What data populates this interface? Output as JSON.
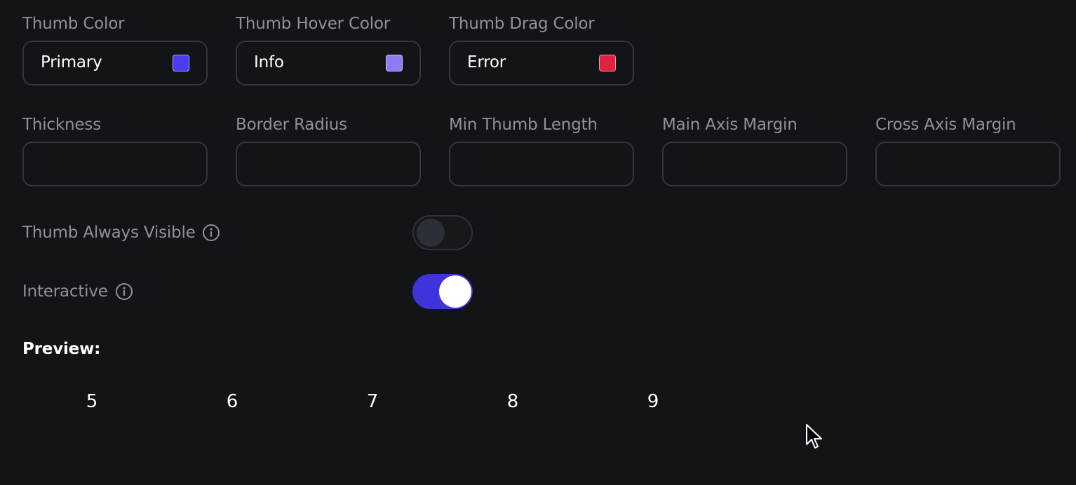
{
  "colors": {
    "thumb_color": {
      "label": "Thumb Color",
      "value": "Primary",
      "swatch": "#4a3cf0"
    },
    "thumb_hover_color": {
      "label": "Thumb Hover Color",
      "value": "Info",
      "swatch": "#8b7cf6"
    },
    "thumb_drag_color": {
      "label": "Thumb Drag Color",
      "value": "Error",
      "swatch": "#e2203f"
    }
  },
  "dimensions": {
    "thickness": {
      "label": "Thickness",
      "value": ""
    },
    "border_radius": {
      "label": "Border Radius",
      "value": ""
    },
    "min_thumb_length": {
      "label": "Min Thumb Length",
      "value": ""
    },
    "main_axis_margin": {
      "label": "Main Axis Margin",
      "value": ""
    },
    "cross_axis_margin": {
      "label": "Cross Axis Margin",
      "value": ""
    }
  },
  "toggles": {
    "thumb_always_visible": {
      "label": "Thumb Always Visible",
      "checked": false,
      "icon": "info-icon"
    },
    "interactive": {
      "label": "Interactive",
      "checked": true,
      "icon": "info-icon"
    }
  },
  "preview": {
    "title": "Preview:",
    "items": [
      "5",
      "6",
      "7",
      "8",
      "9"
    ]
  },
  "accent": "#3f34dc"
}
